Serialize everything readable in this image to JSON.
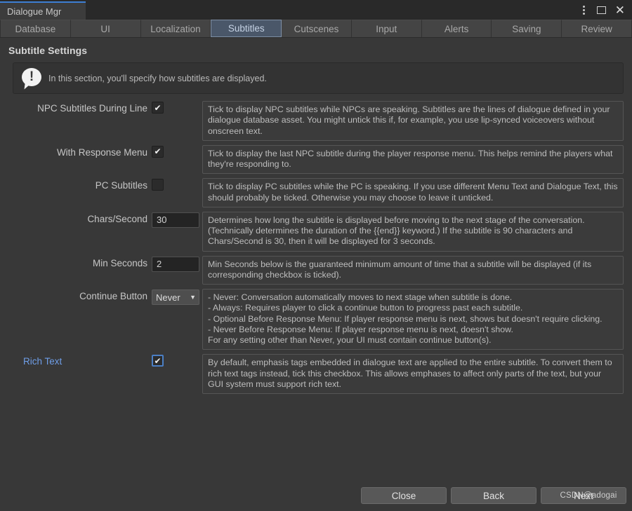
{
  "window": {
    "tab_title": "Dialogue Mgr",
    "controls": {
      "menu_icon": "kebab-menu-icon",
      "maximize_icon": "maximize-icon",
      "close_icon": "close-icon",
      "close_glyph": "✕"
    },
    "accent_color": "#3d7fd4"
  },
  "tabs": [
    {
      "label": "Database",
      "active": false
    },
    {
      "label": "UI",
      "active": false
    },
    {
      "label": "Localization",
      "active": false
    },
    {
      "label": "Subtitles",
      "active": true
    },
    {
      "label": "Cutscenes",
      "active": false
    },
    {
      "label": "Input",
      "active": false
    },
    {
      "label": "Alerts",
      "active": false
    },
    {
      "label": "Saving",
      "active": false
    },
    {
      "label": "Review",
      "active": false
    }
  ],
  "section": {
    "title": "Subtitle Settings",
    "banner": {
      "icon": "info-bubble-icon",
      "glyph": "!",
      "text": "In this section, you'll specify how subtitles are displayed."
    }
  },
  "rows": [
    {
      "label": "NPC Subtitles During Line",
      "control": "checkbox",
      "checked": true,
      "help": "Tick to display NPC subtitles while NPCs are speaking. Subtitles are the lines of dialogue defined in your dialogue database asset. You might untick this if, for example, you use lip-synced voiceovers without onscreen text."
    },
    {
      "label": "With Response Menu",
      "control": "checkbox",
      "checked": true,
      "help": "Tick to display the last NPC subtitle during the player response menu. This helps remind the players what they're responding to."
    },
    {
      "label": "PC Subtitles",
      "control": "checkbox",
      "checked": false,
      "help": "Tick to display PC subtitles while the PC is speaking. If you use different Menu Text and Dialogue Text, this should probably be ticked. Otherwise you may choose to leave it unticked."
    },
    {
      "label": "Chars/Second",
      "control": "number",
      "value": "30",
      "help": "Determines how long the subtitle is displayed before moving to the next stage of the conversation. (Technically determines the duration of the {{end}} keyword.) If the subtitle is 90 characters and Chars/Second is 30, then it will be displayed for 3 seconds."
    },
    {
      "label": "Min Seconds",
      "control": "number",
      "value": "2",
      "help": "Min Seconds below is the guaranteed minimum amount of time that a subtitle will be displayed (if its corresponding checkbox is ticked)."
    },
    {
      "label": "Continue Button",
      "control": "dropdown",
      "value": "Never",
      "caret": "▼",
      "help_lines": [
        "- Never: Conversation automatically moves to next stage when subtitle is done.",
        "- Always: Requires player to click a continue button to progress past each subtitle.",
        "- Optional Before Response Menu: If player response menu is next, shows but doesn't require clicking.",
        "- Never Before Response Menu: If player response menu is next, doesn't show.",
        "For any setting other than Never, your UI must contain continue button(s)."
      ]
    },
    {
      "label": "Rich Text",
      "control": "checkbox",
      "checked": true,
      "focused": true,
      "accent": true,
      "help": "By default, emphasis tags embedded in dialogue text are applied to the entire subtitle. To convert them to rich text tags instead, tick this checkbox. This allows emphases to affect only parts of the text, but your GUI system must support rich text."
    }
  ],
  "footer": {
    "close_label": "Close",
    "back_label": "Back",
    "next_label": "Next",
    "watermark": "CSDN@adogai"
  }
}
